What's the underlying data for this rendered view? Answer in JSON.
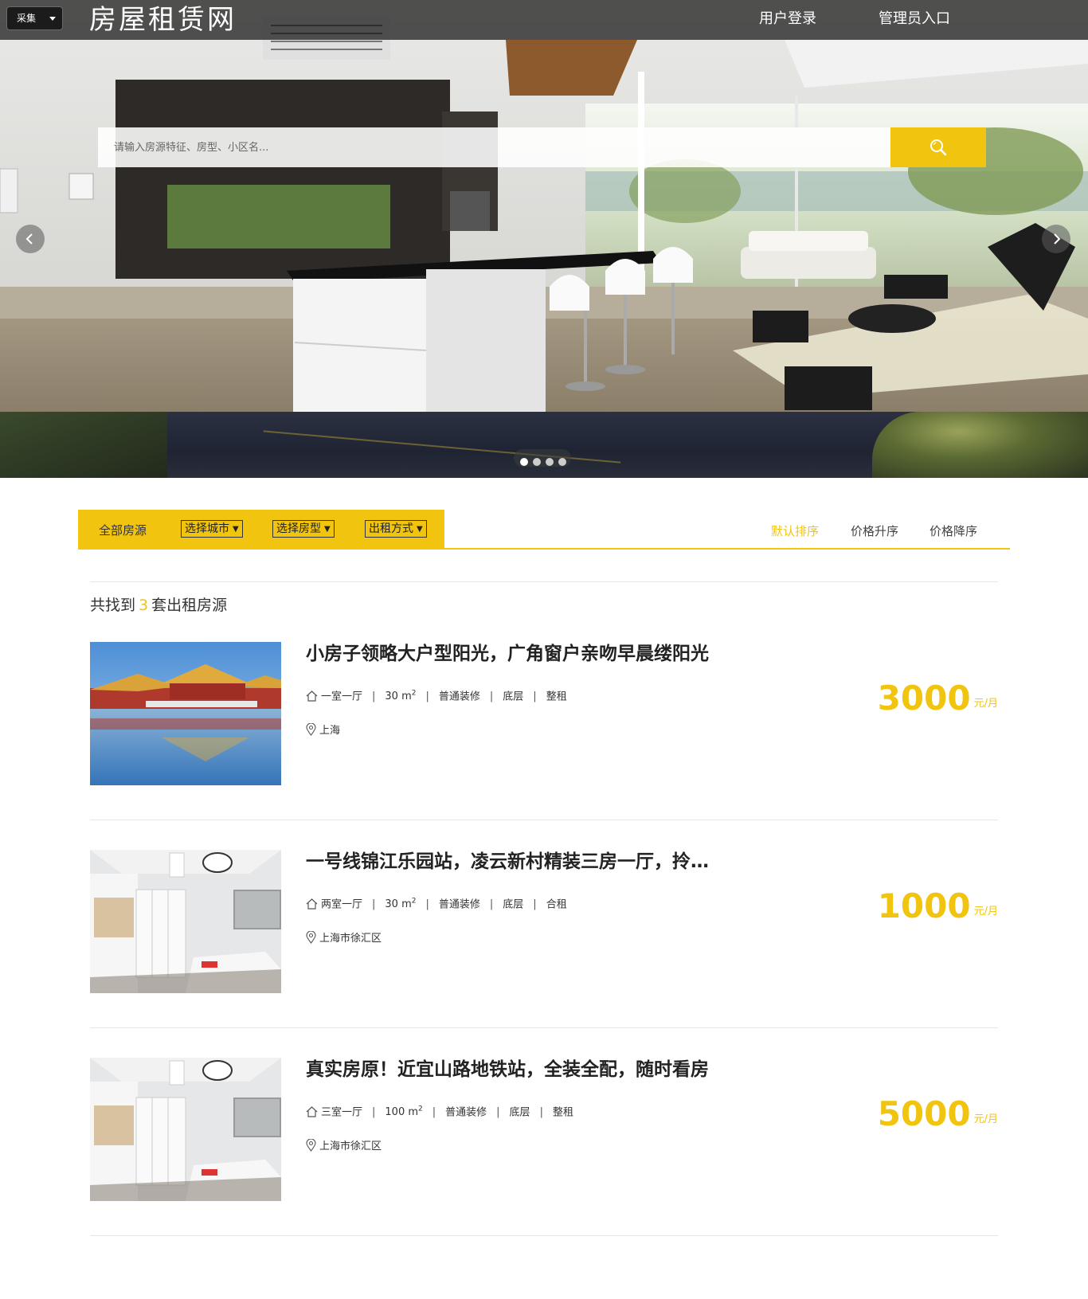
{
  "header": {
    "collect_label": "采集",
    "site_title": "房屋租赁网",
    "nav": {
      "login": "用户登录",
      "admin": "管理员入口"
    }
  },
  "search": {
    "placeholder": "请输入房源特征、房型、小区名..."
  },
  "carousel": {
    "slides": 4,
    "active": 1
  },
  "filters": {
    "all": "全部房源",
    "city": "选择城市",
    "room_type": "选择房型",
    "rent_type": "出租方式",
    "sort": {
      "default": "默认排序",
      "asc": "价格升序",
      "desc": "价格降序"
    }
  },
  "results": {
    "prefix": "共找到",
    "count": "3",
    "suffix": "套出租房源"
  },
  "listings": [
    {
      "title": "小房子领略大户型阳光，广角窗户亲吻早晨缕阳光",
      "layout": "一室一厅",
      "area_value": "30 m",
      "area_sup": "2",
      "decoration": "普通装修",
      "floor": "底层",
      "rent_type": "整租",
      "location": "上海",
      "price": "3000",
      "unit": "元/月",
      "image": "palace"
    },
    {
      "title": "一号线锦江乐园站，凌云新村精装三房一厅，拎包入住",
      "layout": "两室一厅",
      "area_value": "30 m",
      "area_sup": "2",
      "decoration": "普通装修",
      "floor": "底层",
      "rent_type": "合租",
      "location": "上海市徐汇区",
      "price": "1000",
      "unit": "元/月",
      "image": "bedroom"
    },
    {
      "title": "真实房原！近宜山路地铁站，全装全配，随时看房",
      "layout": "三室一厅",
      "area_value": "100 m",
      "area_sup": "2",
      "decoration": "普通装修",
      "floor": "底层",
      "rent_type": "整租",
      "location": "上海市徐汇区",
      "price": "5000",
      "unit": "元/月",
      "image": "bedroom"
    }
  ],
  "colors": {
    "accent": "#f1c40f",
    "topbar": "#141414"
  }
}
